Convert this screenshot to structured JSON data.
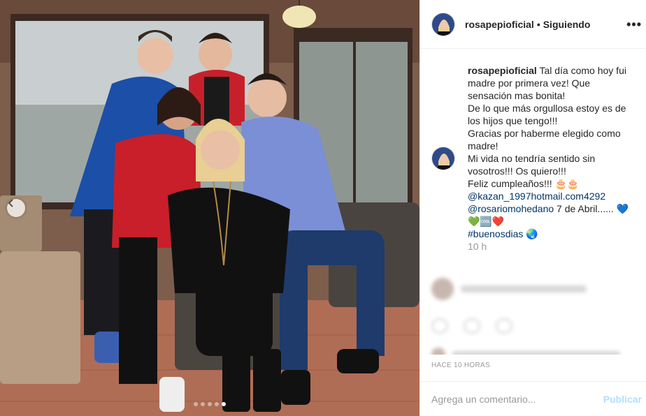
{
  "header": {
    "username": "rosapepioficial",
    "separator": "•",
    "follow_status": "Siguiendo",
    "more_label": "•••"
  },
  "caption": {
    "username": "rosapepioficial",
    "line1": "Tal día como hoy fui madre por primera vez! Que sensación mas bonita!",
    "line2": "De lo que más orgullosa estoy es de los hijos que tengo!!!",
    "line3": "Gracias por haberme elegido como madre!",
    "line4": "Mi vida no tendría sentido sin vosotros!!! Os quiero!!!",
    "line5": "Feliz cumpleaños!!! 🎂🎂",
    "mention1": "@kazan_1997hotmail.com4292",
    "mention2": "@rosariomohedano",
    "line6_tail": " 7 de Abril...... 💙",
    "line7": "💚🆒❤️",
    "hashtag": "#buenosdias",
    "hashtag_emoji": " 🌏",
    "age": "10 h"
  },
  "timestamp": "HACE 10 HORAS",
  "comment": {
    "placeholder": "Agrega un comentario...",
    "publish_label": "Publicar"
  },
  "carousel": {
    "dots": 5,
    "active_index": 4
  },
  "colors": {
    "link": "#003569",
    "muted": "#999999",
    "publish_disabled": "#b2dffc"
  }
}
